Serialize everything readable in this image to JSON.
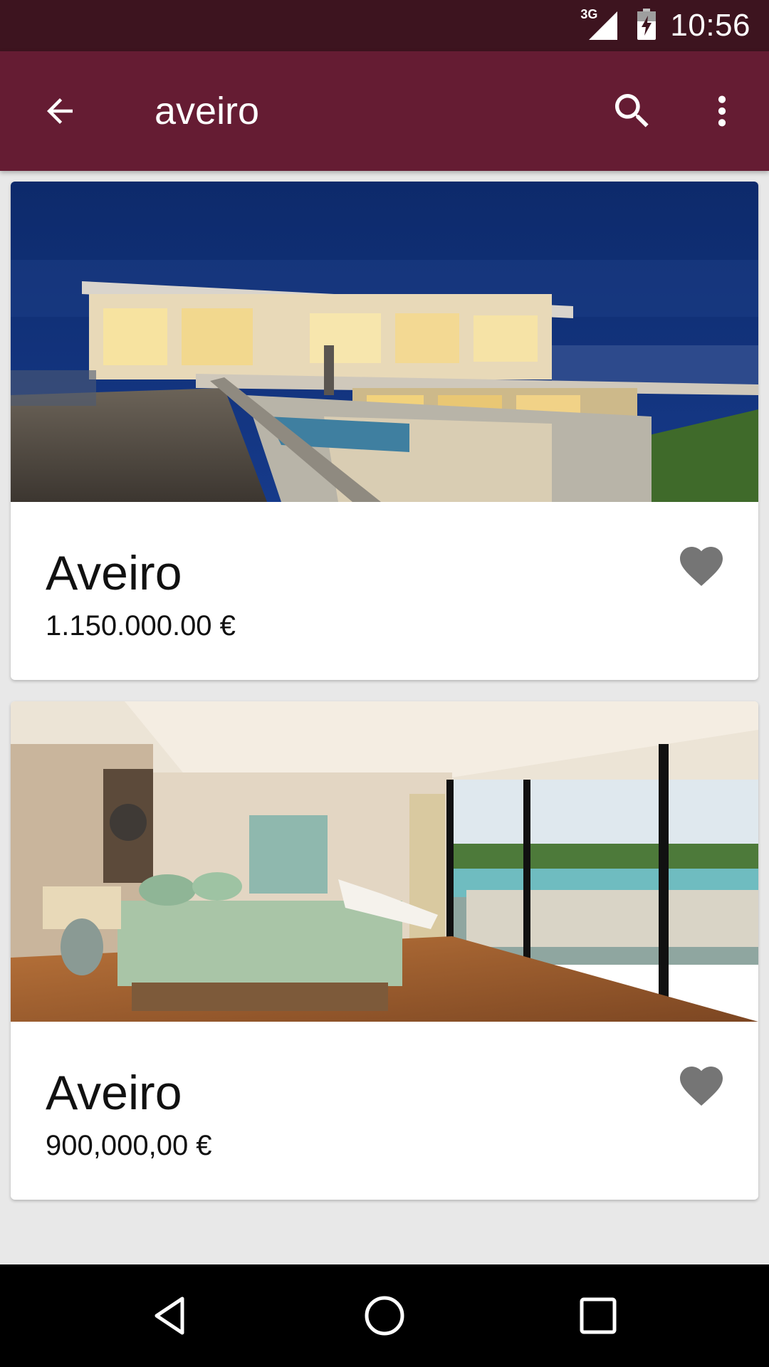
{
  "status_bar": {
    "time": "10:56",
    "network_type": "3G",
    "icons": [
      "signal-icon",
      "battery-charging-icon"
    ]
  },
  "app_bar": {
    "title": "aveiro",
    "icons": [
      "back-arrow-icon",
      "search-icon",
      "more-vert-icon"
    ]
  },
  "listings": [
    {
      "title": "Aveiro",
      "price": "1.150.000.00 €",
      "image": "modern-house-night-photo",
      "favorite_icon": "heart-icon"
    },
    {
      "title": "Aveiro",
      "price": "900,000,00 €",
      "image": "bedroom-interior-photo",
      "favorite_icon": "heart-icon"
    }
  ],
  "nav_bar": {
    "icons": [
      "nav-back-icon",
      "nav-home-icon",
      "nav-recents-icon"
    ]
  },
  "colors": {
    "status_bar": "#3d141f",
    "app_bar": "#651c33",
    "background": "#e8e8e8",
    "card": "#ffffff",
    "heart": "#757575"
  }
}
